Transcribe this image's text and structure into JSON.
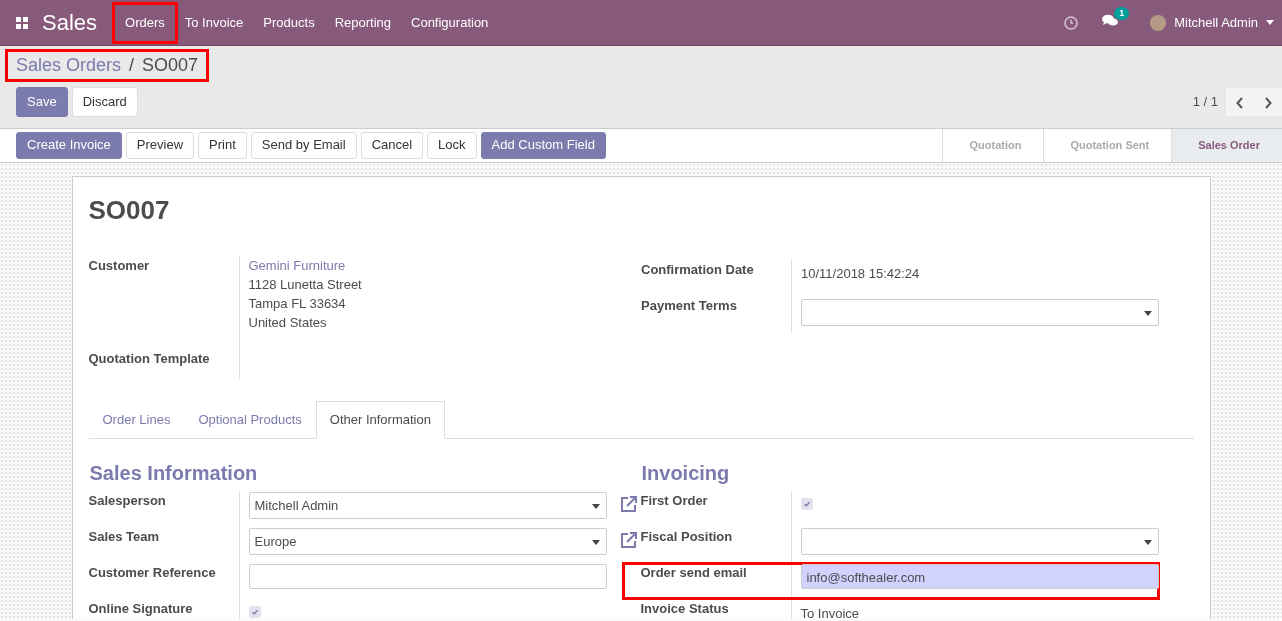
{
  "app": {
    "name": "Sales"
  },
  "menu": [
    {
      "label": "Orders",
      "highlighted": true
    },
    {
      "label": "To Invoice",
      "highlighted": false
    },
    {
      "label": "Products",
      "highlighted": false
    },
    {
      "label": "Reporting",
      "highlighted": false
    },
    {
      "label": "Configuration",
      "highlighted": false
    }
  ],
  "systray": {
    "message_count": "1",
    "user": "Mitchell Admin"
  },
  "breadcrumb": {
    "highlighted": true,
    "separator": "/",
    "items": [
      {
        "label": "Sales Orders",
        "kind": "link"
      },
      {
        "label": "SO007",
        "kind": "current"
      }
    ]
  },
  "edit_buttons": [
    {
      "label": "Save",
      "kind": "primary"
    },
    {
      "label": "Discard",
      "kind": "secondary"
    }
  ],
  "pager": {
    "text": "1 / 1"
  },
  "action_buttons": [
    {
      "label": "Create Invoice",
      "kind": "primary"
    },
    {
      "label": "Preview",
      "kind": "secondary"
    },
    {
      "label": "Print",
      "kind": "secondary"
    },
    {
      "label": "Send by Email",
      "kind": "secondary"
    },
    {
      "label": "Cancel",
      "kind": "secondary"
    },
    {
      "label": "Lock",
      "kind": "secondary"
    },
    {
      "label": "Add Custom Field",
      "kind": "primary"
    }
  ],
  "statusbar": [
    {
      "label": "Quotation",
      "selected": false
    },
    {
      "label": "Quotation Sent",
      "selected": false
    },
    {
      "label": "Sales Order",
      "selected": true
    }
  ],
  "record": {
    "title": "SO007"
  },
  "header_left": [
    {
      "label": "Customer",
      "kind": "address",
      "link": "Gemini Furniture",
      "lines": [
        "1128 Lunetta Street",
        "Tampa FL 33634",
        "United States"
      ]
    },
    {
      "label": "Quotation Template",
      "kind": "empty"
    }
  ],
  "header_right": [
    {
      "label": "Confirmation Date",
      "kind": "text",
      "value": "10/11/2018 15:42:24"
    },
    {
      "label": "Payment Terms",
      "kind": "select"
    }
  ],
  "tabs": [
    {
      "label": "Order Lines",
      "selected": false
    },
    {
      "label": "Optional Products",
      "selected": false
    },
    {
      "label": "Other Information",
      "selected": true
    }
  ],
  "groups": [
    {
      "title": "Sales Information",
      "fields": [
        {
          "label": "Salesperson",
          "kind": "select",
          "value": "Mitchell Admin",
          "external_link": true
        },
        {
          "label": "Sales Team",
          "kind": "select",
          "value": "Europe",
          "external_link": true
        },
        {
          "label": "Customer Reference",
          "kind": "input"
        },
        {
          "label": "Online Signature",
          "kind": "checkbox",
          "checked": true
        }
      ]
    },
    {
      "title": "Invoicing",
      "fields": [
        {
          "label": "First Order",
          "kind": "checkbox",
          "checked": true
        },
        {
          "label": "Fiscal Position",
          "kind": "select"
        },
        {
          "label": "Order send email",
          "kind": "input",
          "value": "info@softhealer.com",
          "highlighted": true
        },
        {
          "label": "Invoice Status",
          "kind": "text",
          "value": "To Invoice"
        }
      ]
    }
  ]
}
